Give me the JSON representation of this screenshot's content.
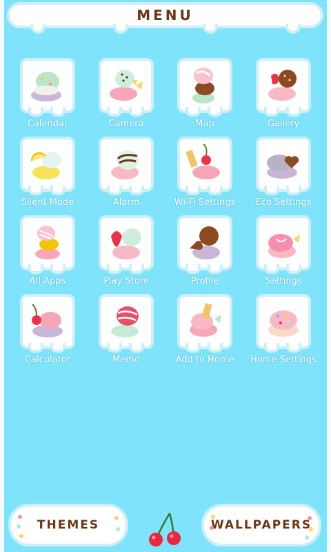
{
  "header": {
    "title": "MENU"
  },
  "apps": [
    {
      "label": "Calendar",
      "icon": "ice-cream-mint-icon"
    },
    {
      "label": "Camera",
      "icon": "ice-cream-strawberry-icon"
    },
    {
      "label": "Map",
      "icon": "ice-cream-stack-icon"
    },
    {
      "label": "Gallery",
      "icon": "ice-cream-cookie-icon"
    },
    {
      "label": "Silent Mode",
      "icon": "ice-cream-lemon-icon"
    },
    {
      "label": "Alarm",
      "icon": "ice-cream-swirl-icon"
    },
    {
      "label": "Wi-Fi Settings",
      "icon": "ice-cream-cherry-wafer-icon"
    },
    {
      "label": "Eco Settings",
      "icon": "ice-cream-heart-icon"
    },
    {
      "label": "All Apps",
      "icon": "ice-cream-tower-icon"
    },
    {
      "label": "Play Store",
      "icon": "ice-cream-strawberry-mint-icon"
    },
    {
      "label": "Profile",
      "icon": "ice-cream-chocolate-icon"
    },
    {
      "label": "Settings",
      "icon": "ice-cream-bow-icon"
    },
    {
      "label": "Calculator",
      "icon": "ice-cream-cherry-icon"
    },
    {
      "label": "Memo",
      "icon": "ice-cream-raspberry-icon"
    },
    {
      "label": "Add to Home",
      "icon": "ice-cream-wafer-bow-icon"
    },
    {
      "label": "Home Settings",
      "icon": "ice-cream-sprinkles-icon"
    }
  ],
  "footer": {
    "themes_label": "THEMES",
    "wallpapers_label": "WALLPAPERS"
  },
  "colors": {
    "background": "#7fe3fb",
    "tile_border": "#cdeff8",
    "title_brown": "#6b3414",
    "label": "#ffffff"
  }
}
